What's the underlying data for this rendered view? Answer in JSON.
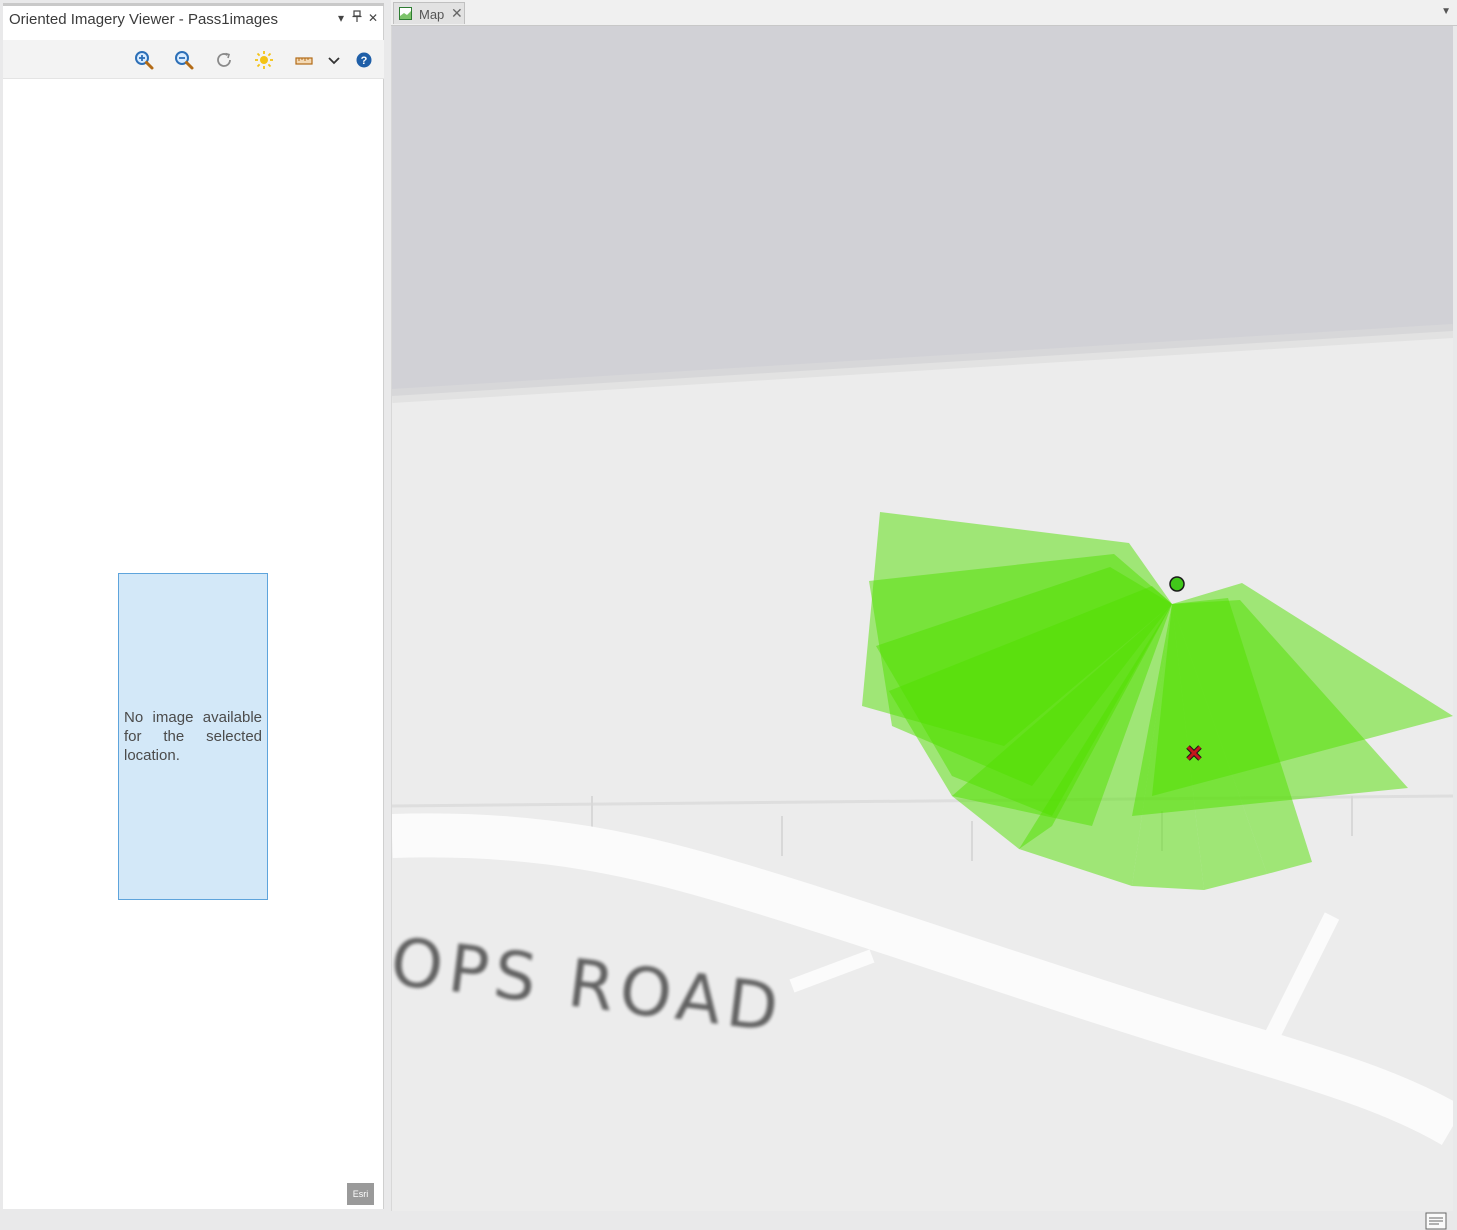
{
  "viewer": {
    "title": "Oriented Imagery Viewer - Pass1images",
    "controls": {
      "menu_icon": "dropdown-arrow-icon",
      "pin_icon": "pin-icon",
      "close_icon": "close-icon"
    },
    "toolbar": [
      {
        "name": "zoom-in-button",
        "icon": "zoom-in-icon"
      },
      {
        "name": "zoom-out-button",
        "icon": "zoom-out-icon"
      },
      {
        "name": "refresh-button",
        "icon": "refresh-icon"
      },
      {
        "name": "brightness-button",
        "icon": "sun-icon"
      },
      {
        "name": "measure-button",
        "icon": "ruler-icon"
      },
      {
        "name": "measure-dropdown-button",
        "icon": "chevron-down-icon"
      },
      {
        "name": "help-button",
        "icon": "help-icon"
      }
    ],
    "message": "No image available for the selected location.",
    "attribution": "Esri"
  },
  "map": {
    "tab_label": "Map",
    "road_label": "OPS ROAD",
    "colors": {
      "coverage_fill": "#52e000",
      "camera_point": "#41c81a",
      "selected_marker": "#c4161c",
      "background": "#ececec",
      "upper_band": "#d1d1d6"
    }
  }
}
